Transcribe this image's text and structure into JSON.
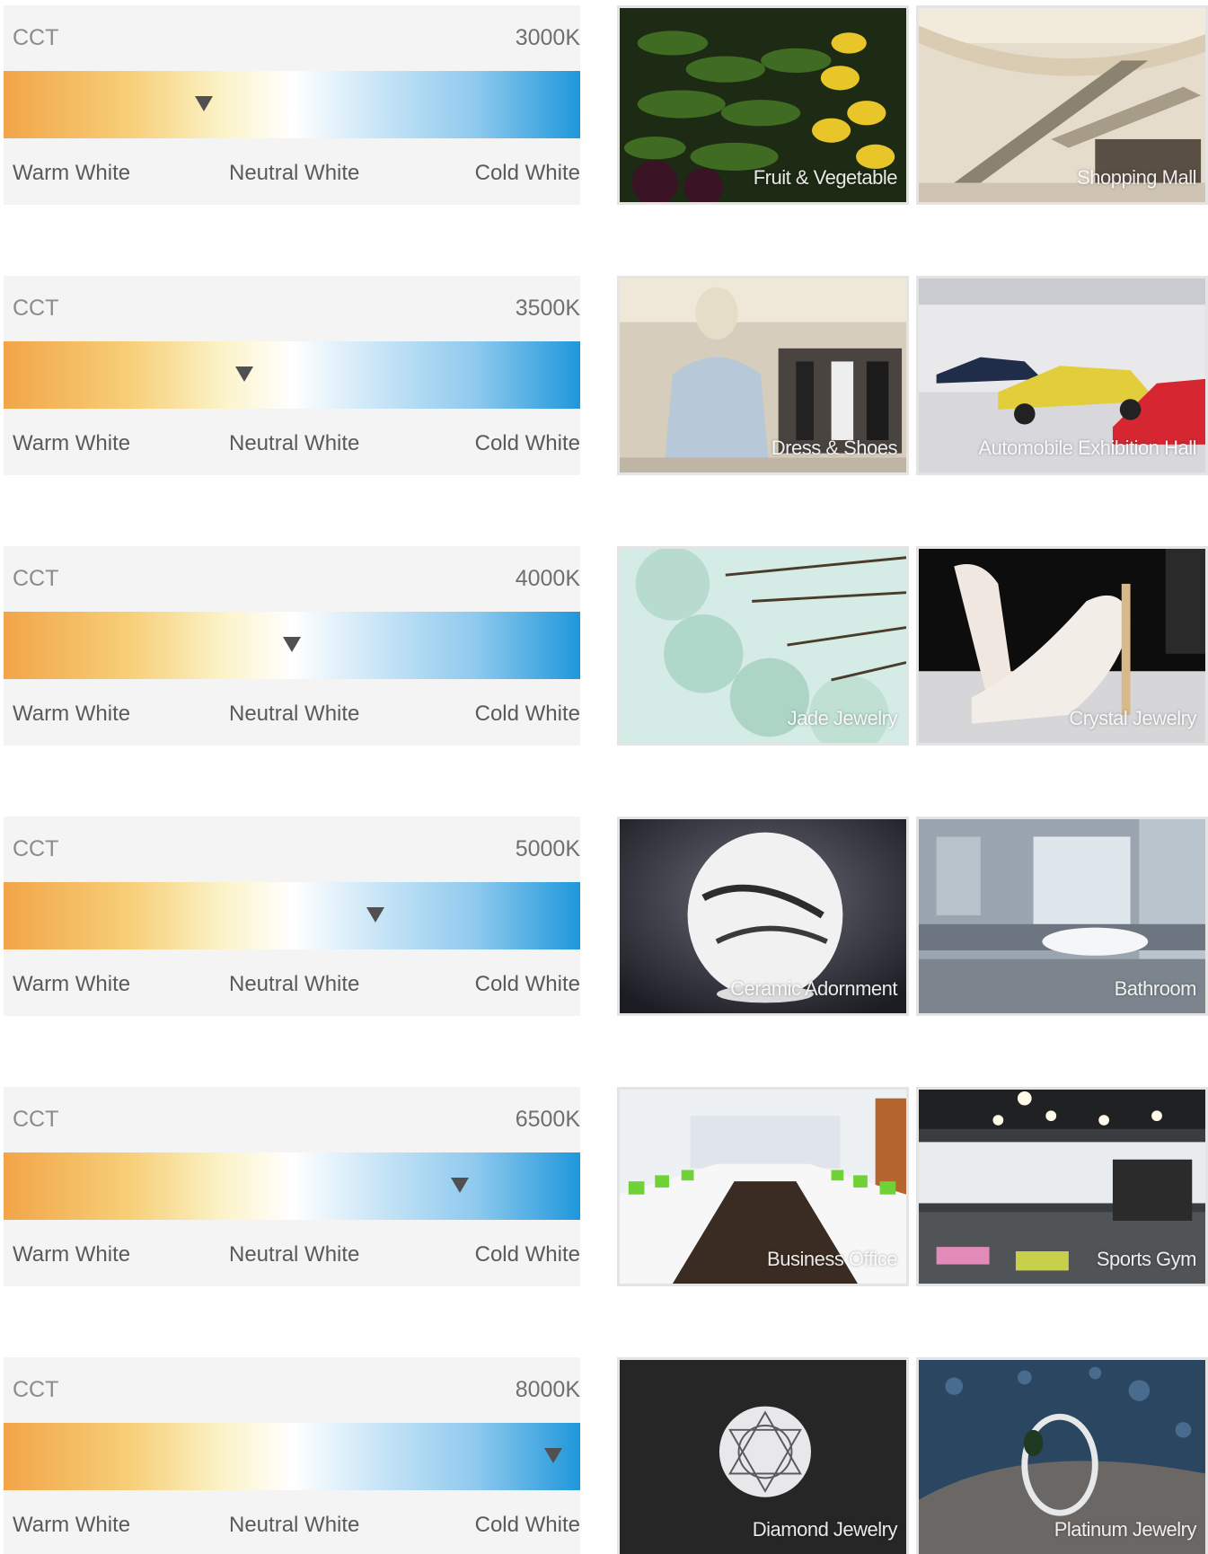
{
  "rows": [
    {
      "cct_label": "CCT",
      "cct_value": "3000K",
      "marker_position": 0.348,
      "scale": {
        "warm": "Warm White",
        "neutral": "Neutral White",
        "cold": "Cold White"
      },
      "photos": [
        {
          "caption": "Fruit & Vegetable",
          "subject": "vegetables"
        },
        {
          "caption": "Shopping Mall",
          "subject": "mall"
        }
      ]
    },
    {
      "cct_label": "CCT",
      "cct_value": "3500K",
      "marker_position": 0.418,
      "scale": {
        "warm": "Warm White",
        "neutral": "Neutral White",
        "cold": "Cold White"
      },
      "photos": [
        {
          "caption": "Dress & Shoes",
          "subject": "clothing-store"
        },
        {
          "caption": "Automobile Exhibition Hall",
          "subject": "car-showroom"
        }
      ]
    },
    {
      "cct_label": "CCT",
      "cct_value": "4000K",
      "marker_position": 0.5,
      "scale": {
        "warm": "Warm White",
        "neutral": "Neutral White",
        "cold": "Cold White"
      },
      "photos": [
        {
          "caption": "Jade Jewelry",
          "subject": "jade"
        },
        {
          "caption": "Crystal Jewelry",
          "subject": "crystal-shoes"
        }
      ]
    },
    {
      "cct_label": "CCT",
      "cct_value": "5000K",
      "marker_position": 0.645,
      "scale": {
        "warm": "Warm White",
        "neutral": "Neutral White",
        "cold": "Cold White"
      },
      "photos": [
        {
          "caption": "Ceramic Adornment",
          "subject": "ceramic-vase"
        },
        {
          "caption": "Bathroom",
          "subject": "bathroom"
        }
      ]
    },
    {
      "cct_label": "CCT",
      "cct_value": "6500K",
      "marker_position": 0.792,
      "scale": {
        "warm": "Warm White",
        "neutral": "Neutral White",
        "cold": "Cold White"
      },
      "photos": [
        {
          "caption": "Business Office",
          "subject": "office"
        },
        {
          "caption": "Sports Gym",
          "subject": "gym"
        }
      ]
    },
    {
      "cct_label": "CCT",
      "cct_value": "8000K",
      "marker_position": 0.953,
      "scale": {
        "warm": "Warm White",
        "neutral": "Neutral White",
        "cold": "Cold White"
      },
      "photos": [
        {
          "caption": "Diamond Jewelry",
          "subject": "diamond"
        },
        {
          "caption": "Platinum Jewelry",
          "subject": "platinum-ring"
        }
      ]
    }
  ]
}
